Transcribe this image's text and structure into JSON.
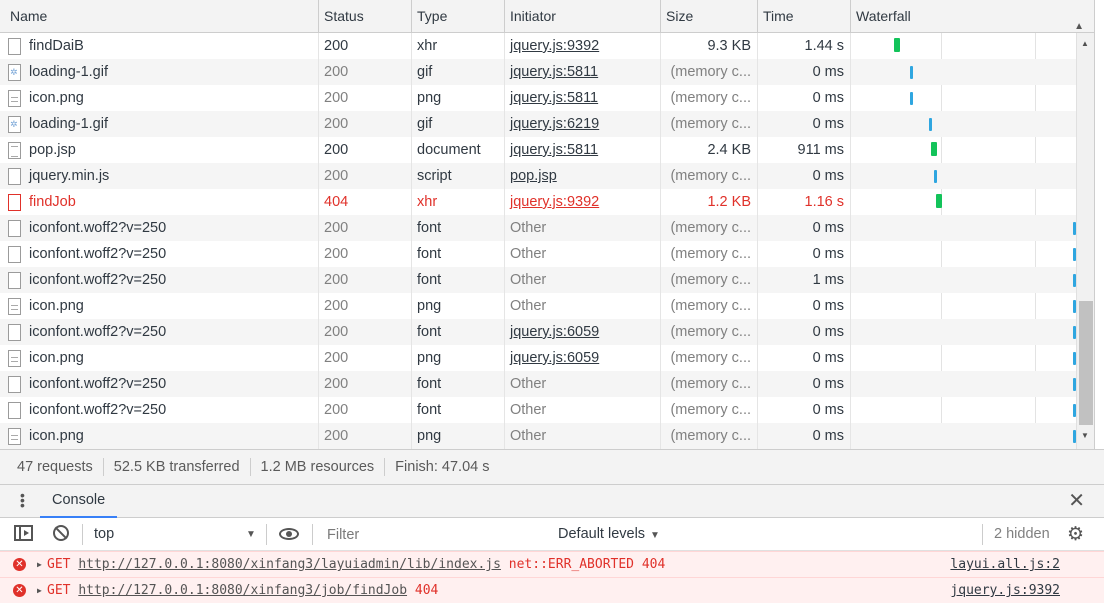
{
  "columns": {
    "name": "Name",
    "status": "Status",
    "type": "Type",
    "initiator": "Initiator",
    "size": "Size",
    "time": "Time",
    "waterfall": "Waterfall"
  },
  "rows": [
    {
      "name": "findDaiB",
      "status": "200",
      "type": "xhr",
      "initiator": "jquery.js:9392",
      "size": "9.3 KB",
      "time": "1.44 s",
      "icon": "file-icon"
    },
    {
      "name": "loading-1.gif",
      "status": "200",
      "type": "gif",
      "initiator": "jquery.js:5811",
      "size": "(memory c...",
      "time": "0 ms",
      "icon": "gif-file-icon"
    },
    {
      "name": "icon.png",
      "status": "200",
      "type": "png",
      "initiator": "jquery.js:5811",
      "size": "(memory c...",
      "time": "0 ms",
      "icon": "image-file-icon"
    },
    {
      "name": "loading-1.gif",
      "status": "200",
      "type": "gif",
      "initiator": "jquery.js:6219",
      "size": "(memory c...",
      "time": "0 ms",
      "icon": "gif-file-icon"
    },
    {
      "name": "pop.jsp",
      "status": "200",
      "type": "document",
      "initiator": "jquery.js:5811",
      "size": "2.4 KB",
      "time": "911 ms",
      "icon": "document-file-icon"
    },
    {
      "name": "jquery.min.js",
      "status": "200",
      "type": "script",
      "initiator": "pop.jsp",
      "size": "(memory c...",
      "time": "0 ms",
      "icon": "file-icon"
    },
    {
      "name": "findJob",
      "status": "404",
      "type": "xhr",
      "initiator": "jquery.js:9392",
      "size": "1.2 KB",
      "time": "1.16 s",
      "icon": "file-icon",
      "error": true
    },
    {
      "name": "iconfont.woff2?v=250",
      "status": "200",
      "type": "font",
      "initiator": "Other",
      "size": "(memory c...",
      "time": "0 ms",
      "icon": "file-icon"
    },
    {
      "name": "iconfont.woff2?v=250",
      "status": "200",
      "type": "font",
      "initiator": "Other",
      "size": "(memory c...",
      "time": "0 ms",
      "icon": "file-icon"
    },
    {
      "name": "iconfont.woff2?v=250",
      "status": "200",
      "type": "font",
      "initiator": "Other",
      "size": "(memory c...",
      "time": "1 ms",
      "icon": "file-icon"
    },
    {
      "name": "icon.png",
      "status": "200",
      "type": "png",
      "initiator": "Other",
      "size": "(memory c...",
      "time": "0 ms",
      "icon": "image-file-icon"
    },
    {
      "name": "iconfont.woff2?v=250",
      "status": "200",
      "type": "font",
      "initiator": "jquery.js:6059",
      "size": "(memory c...",
      "time": "0 ms",
      "icon": "file-icon"
    },
    {
      "name": "icon.png",
      "status": "200",
      "type": "png",
      "initiator": "jquery.js:6059",
      "size": "(memory c...",
      "time": "0 ms",
      "icon": "image-file-icon"
    },
    {
      "name": "iconfont.woff2?v=250",
      "status": "200",
      "type": "font",
      "initiator": "Other",
      "size": "(memory c...",
      "time": "0 ms",
      "icon": "file-icon"
    },
    {
      "name": "iconfont.woff2?v=250",
      "status": "200",
      "type": "font",
      "initiator": "Other",
      "size": "(memory c...",
      "time": "0 ms",
      "icon": "file-icon"
    },
    {
      "name": "icon.png",
      "status": "200",
      "type": "png",
      "initiator": "Other",
      "size": "(memory c...",
      "time": "0 ms",
      "icon": "image-file-icon"
    }
  ],
  "summary": {
    "requests": "47 requests",
    "transferred": "52.5 KB transferred",
    "resources": "1.2 MB resources",
    "finish": "Finish: 47.04 s"
  },
  "drawer": {
    "tab_console": "Console"
  },
  "console_toolbar": {
    "context": "top",
    "filter_placeholder": "Filter",
    "levels": "Default levels",
    "hidden": "2 hidden"
  },
  "messages": [
    {
      "method": "GET",
      "url": "http://127.0.0.1:8080/xinfang3/layuiadmin/lib/index.js",
      "detail": "net::ERR_ABORTED 404",
      "source": "layui.all.js:2"
    },
    {
      "method": "GET",
      "url": "http://127.0.0.1:8080/xinfang3/job/findJob",
      "detail": "404",
      "source": "jquery.js:9392"
    }
  ],
  "colors": {
    "error": "#e0312a",
    "waterfall_green": "#13c35a",
    "waterfall_blue": "#2fa6e0",
    "accent": "#3880f7"
  },
  "icons": [
    "sort-ascending-icon",
    "scroll-up-icon",
    "scroll-down-icon",
    "kebab-menu-icon",
    "close-icon",
    "sidebar-toggle-icon",
    "clear-console-icon",
    "dropdown-caret-icon",
    "eye-icon",
    "gear-icon",
    "error-icon",
    "expand-triangle-icon"
  ]
}
